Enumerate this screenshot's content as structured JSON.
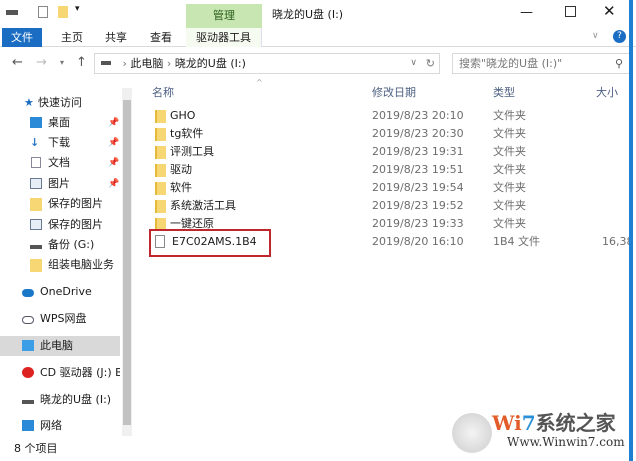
{
  "title": "晓龙的U盘 (I:)",
  "ribbon": {
    "manage": "管理",
    "drive_tools": "驱动器工具",
    "tabs": [
      "文件",
      "主页",
      "共享",
      "查看"
    ]
  },
  "address": {
    "segments": [
      "此电脑",
      "晓龙的U盘 (I:)"
    ],
    "search_placeholder": "搜索\"晓龙的U盘 (I:)\""
  },
  "nav": [
    {
      "label": "快速访问",
      "icon": "star-icon"
    },
    {
      "label": "桌面",
      "icon": "desktop-icon",
      "pinned": true
    },
    {
      "label": "下载",
      "icon": "download-icon",
      "pinned": true
    },
    {
      "label": "文档",
      "icon": "document-icon",
      "pinned": true
    },
    {
      "label": "图片",
      "icon": "picture-icon",
      "pinned": true
    },
    {
      "label": "保存的图片",
      "icon": "folder-icon"
    },
    {
      "label": "保存的图片",
      "icon": "picture-icon"
    },
    {
      "label": "备份 (G:)",
      "icon": "drive-icon"
    },
    {
      "label": "组装电脑业务",
      "icon": "folder-icon"
    },
    {
      "label": "OneDrive",
      "icon": "cloud-icon"
    },
    {
      "label": "WPS网盘",
      "icon": "cloud-outline-icon"
    },
    {
      "label": "此电脑",
      "icon": "computer-icon",
      "selected": true
    },
    {
      "label": "CD 驱动器 (J:) BC",
      "icon": "cd-icon"
    },
    {
      "label": "晓龙的U盘 (I:)",
      "icon": "drive-icon"
    },
    {
      "label": "网络",
      "icon": "network-icon"
    }
  ],
  "columns": {
    "name": "名称",
    "date": "修改日期",
    "type": "类型",
    "size": "大小"
  },
  "files": [
    {
      "name": "GHO",
      "date": "2019/8/23 20:10",
      "type": "文件夹",
      "size": ""
    },
    {
      "name": "tg软件",
      "date": "2019/8/23 20:30",
      "type": "文件夹",
      "size": ""
    },
    {
      "name": "评测工具",
      "date": "2019/8/23 19:31",
      "type": "文件夹",
      "size": ""
    },
    {
      "name": "驱动",
      "date": "2019/8/23 19:51",
      "type": "文件夹",
      "size": ""
    },
    {
      "name": "软件",
      "date": "2019/8/23 19:54",
      "type": "文件夹",
      "size": ""
    },
    {
      "name": "系统激活工具",
      "date": "2019/8/23 19:52",
      "type": "文件夹",
      "size": ""
    },
    {
      "name": "一键还原",
      "date": "2019/8/23 19:33",
      "type": "文件夹",
      "size": ""
    },
    {
      "name": "E7C02AMS.1B4",
      "date": "2019/8/20 16:10",
      "type": "1B4 文件",
      "size": "16,38"
    }
  ],
  "status": "8 个项目",
  "watermark": {
    "brand": "Win7系统之家",
    "url": "Www.Winwin7.com"
  }
}
